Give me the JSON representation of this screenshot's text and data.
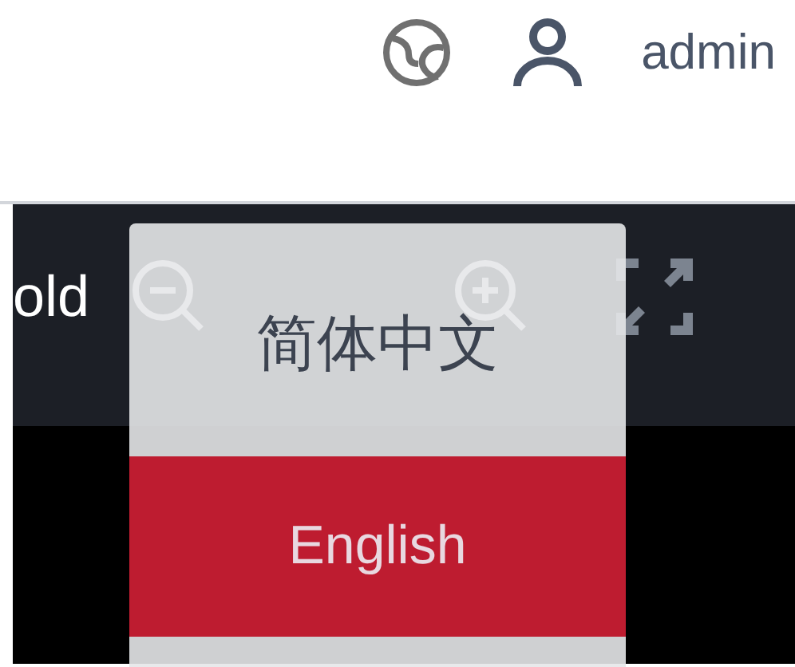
{
  "header": {
    "user": "admin"
  },
  "toolbar": {
    "title": "old"
  },
  "language_menu": {
    "items": [
      {
        "label": "简体中文",
        "selected": false
      },
      {
        "label": "English",
        "selected": true
      }
    ]
  }
}
